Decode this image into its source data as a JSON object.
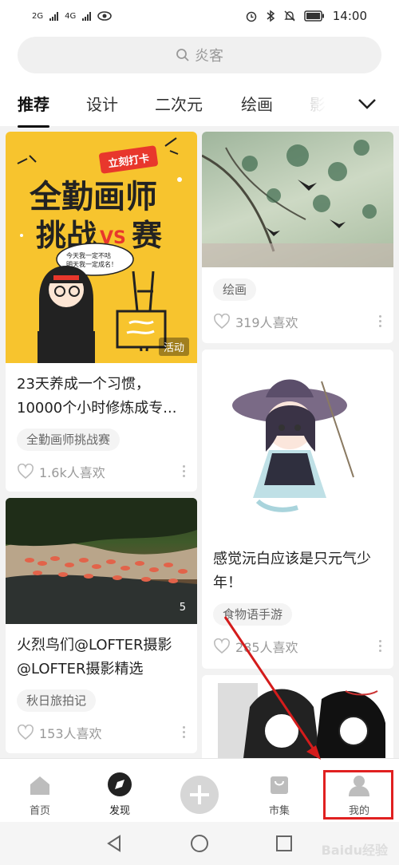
{
  "status_bar": {
    "network1": "2G",
    "network2": "4G",
    "time": "14:00"
  },
  "search": {
    "placeholder": "炎客"
  },
  "tabs": [
    "推荐",
    "设计",
    "二次元",
    "绘画",
    "影视"
  ],
  "cards": [
    {
      "title": "23天养成一个习惯，10000个小时修炼成专...",
      "tag": "全勤画师挑战赛",
      "likes": "1.6k人喜欢",
      "badge": "活动",
      "poster": {
        "banner": "立刻打卡",
        "line1": "全勤画师",
        "line2a": "挑战",
        "vs": "VS",
        "line2b": "赛",
        "bubble1": "今天我一定不咕",
        "bubble2": "明天我一定成名！"
      }
    },
    {
      "title": "火烈鸟们@LOFTER摄影 @LOFTER摄影精选",
      "tag": "秋日旅拍记",
      "likes": "153人喜欢",
      "badge": "5"
    },
    {
      "tag": "绘画",
      "likes": "319人喜欢"
    },
    {
      "title": "感觉沅白应该是只元气少年！",
      "tag": "食物语手游",
      "likes": "285人喜欢"
    }
  ],
  "bottom_nav": [
    {
      "label": "首页",
      "icon": "home-icon"
    },
    {
      "label": "发现",
      "icon": "compass-icon"
    },
    {
      "label": "",
      "icon": "plus-icon"
    },
    {
      "label": "市集",
      "icon": "market-bag-icon"
    },
    {
      "label": "我的",
      "icon": "profile-icon"
    }
  ],
  "watermark": "Baidu经验",
  "colors": {
    "highlight": "#e02020",
    "accent_yellow": "#f7c42e"
  }
}
